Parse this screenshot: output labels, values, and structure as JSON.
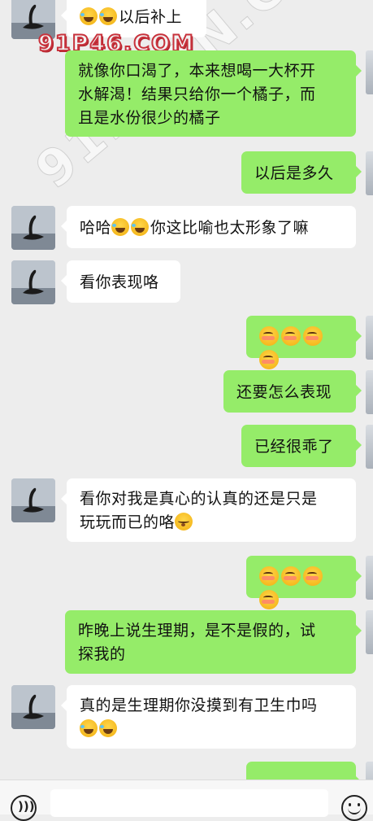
{
  "watermark": {
    "site_logo": "91P46.COM",
    "diagonal": "91PORN.COM"
  },
  "messages": [
    {
      "side": "in",
      "text": "以后补上",
      "emoji_before": [
        "laugh",
        "laugh"
      ]
    },
    {
      "side": "out",
      "lines": [
        "就像你口渴了，本来想喝一大杯开",
        "水解渴！结果只给你一个橘子，而",
        "且是水份很少的橘子"
      ]
    },
    {
      "side": "out",
      "text": "以后是多久"
    },
    {
      "side": "in",
      "text_a": "哈哈",
      "text_b": "你这比喻也太形象了嘛"
    },
    {
      "side": "in",
      "text": "看你表现咯"
    },
    {
      "side": "out",
      "emoji_only": [
        "shy",
        "shy",
        "shy",
        "shy"
      ]
    },
    {
      "side": "out",
      "text": "还要怎么表现"
    },
    {
      "side": "out",
      "text": "已经很乖了"
    },
    {
      "side": "in",
      "lines": [
        "看你对我是真心的认真的还是只是",
        "玩玩而已的咯"
      ]
    },
    {
      "side": "out",
      "emoji_only": [
        "shy",
        "shy",
        "shy",
        "shy"
      ]
    },
    {
      "side": "out",
      "lines": [
        "昨晚上说生理期，是不是假的，试",
        "探我的"
      ]
    },
    {
      "side": "in",
      "lines": [
        "真的是生理期你没摸到有卫生巾吗"
      ]
    }
  ],
  "input": {
    "placeholder": ""
  },
  "colors": {
    "background": "#ededed",
    "outgoing": "#95ec69",
    "incoming": "#ffffff"
  }
}
